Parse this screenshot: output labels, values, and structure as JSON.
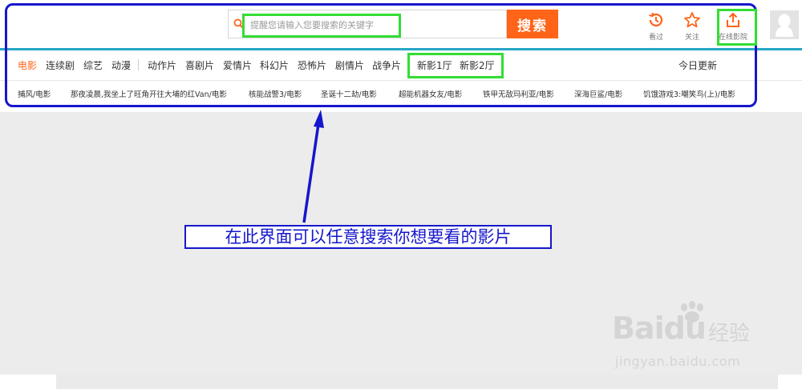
{
  "search": {
    "placeholder": "提醒您请输入您要搜索的关键字",
    "button_label": "搜索"
  },
  "top_actions": [
    {
      "label": "看过",
      "icon": "history-icon"
    },
    {
      "label": "关注",
      "icon": "star-icon"
    },
    {
      "label": "在线影院",
      "icon": "upload-icon"
    }
  ],
  "nav": {
    "items": [
      "电影",
      "连续剧",
      "综艺",
      "动漫",
      "动作片",
      "喜剧片",
      "爱情片",
      "科幻片",
      "恐怖片",
      "剧情片",
      "战争片",
      "新影1厅",
      "新影2厅"
    ],
    "active": "电影",
    "right_link": "今日更新"
  },
  "movies": [
    "捕风/电影",
    "那夜凌晨,我坐上了旺角开往大埔的红Van/电影",
    "核能战警3/电影",
    "圣诞十二劫/电影",
    "超能机器女友/电影",
    "铁甲无敌玛利亚/电影",
    "深海巨鲨/电影",
    "饥饿游戏3:嘲笑鸟(上)/电影"
  ],
  "annotation": {
    "text": "在此界面可以任意搜索你想要看的影片"
  },
  "watermark": {
    "logo": "Baidu",
    "cn": "经验",
    "url": "jingyan.baidu.com"
  },
  "colors": {
    "accent": "#ff6418",
    "annotation_blue": "#1616cc",
    "highlight_green": "#33dd33",
    "teal_line": "#25a7c6"
  }
}
